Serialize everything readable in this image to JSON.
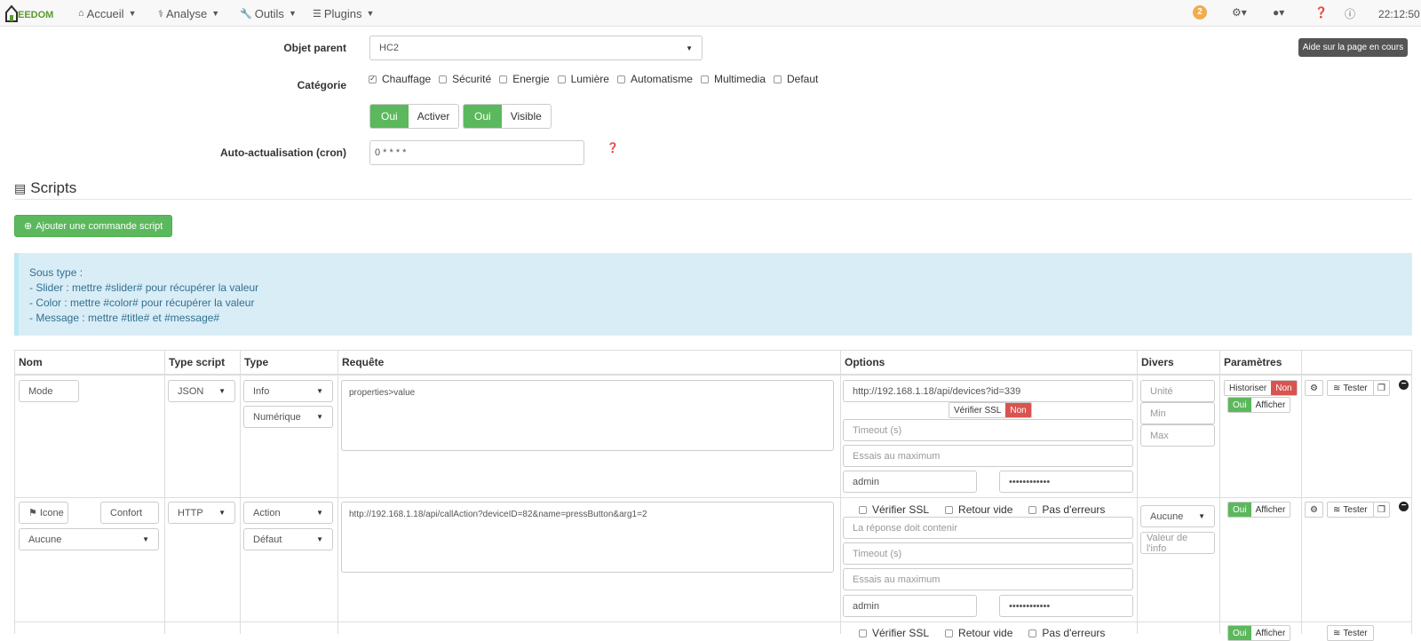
{
  "nav": {
    "logo_text": "EEDOM",
    "accueil": "Accueil",
    "analyse": "Analyse",
    "outils": "Outils",
    "plugins": "Plugins",
    "badge_count": "2",
    "clock": "22:12:50"
  },
  "help_tooltip": "Aide sur la page en cours",
  "form": {
    "parent_label": "Objet parent",
    "parent_value": "HC2",
    "category_label": "Catégorie",
    "categories": [
      {
        "label": "Chauffage",
        "checked": true
      },
      {
        "label": "Sécurité",
        "checked": false
      },
      {
        "label": "Energie",
        "checked": false
      },
      {
        "label": "Lumière",
        "checked": false
      },
      {
        "label": "Automatisme",
        "checked": false
      },
      {
        "label": "Multimedia",
        "checked": false
      },
      {
        "label": "Defaut",
        "checked": false
      }
    ],
    "enable_on": "Oui",
    "enable_label": "Activer",
    "visible_on": "Oui",
    "visible_label": "Visible",
    "cron_label": "Auto-actualisation (cron)",
    "cron_value": "0 * * * *"
  },
  "scripts": {
    "title": "Scripts",
    "add_button": "Ajouter une commande script",
    "info_lines": [
      "Sous type :",
      "- Slider : mettre #slider# pour récupérer la valeur",
      "- Color : mettre #color# pour récupérer la valeur",
      "- Message : mettre #title# et #message#"
    ]
  },
  "table": {
    "headers": [
      "Nom",
      "Type script",
      "Type",
      "Requête",
      "Options",
      "Divers",
      "Paramètres"
    ],
    "row1": {
      "name": "Mode",
      "script_type": "JSON",
      "type": "Info",
      "subtype": "Numérique",
      "request": "properties>value",
      "url": "http://192.168.1.18/api/devices?id=339",
      "verify_ssl": "Vérifier SSL",
      "verify_ssl_state": "Non",
      "timeout_ph": "Timeout (s)",
      "retries_ph": "Essais au maximum",
      "user": "admin",
      "password": "••••••••••••",
      "unit_ph": "Unité",
      "min_ph": "Min",
      "max_ph": "Max",
      "historize": "Historiser",
      "historize_state": "Non",
      "display_on": "Oui",
      "display": "Afficher",
      "test": "Tester"
    },
    "row2": {
      "icon_label": "Icone",
      "name": "Confort",
      "script_type": "HTTP",
      "type": "Action",
      "subtype": "Défaut",
      "value_select": "Aucune",
      "request": "http://192.168.1.18/api/callAction?deviceID=82&name=pressButton&arg1=2",
      "verify_ssl": "Vérifier SSL",
      "empty_return": "Retour vide",
      "no_errors": "Pas d'erreurs",
      "must_contain_ph": "La réponse doit contenir",
      "timeout_ph": "Timeout (s)",
      "retries_ph": "Essais au maximum",
      "user": "admin",
      "password": "••••••••••••",
      "divers_select": "Aucune",
      "info_value_ph": "Valeur de l'info",
      "display_on": "Oui",
      "display": "Afficher",
      "test": "Tester"
    },
    "row3": {
      "verify_ssl": "Vérifier SSL",
      "empty_return": "Retour vide",
      "no_errors": "Pas d'erreurs",
      "display_on": "Oui",
      "display": "Afficher",
      "test": "Tester"
    }
  }
}
